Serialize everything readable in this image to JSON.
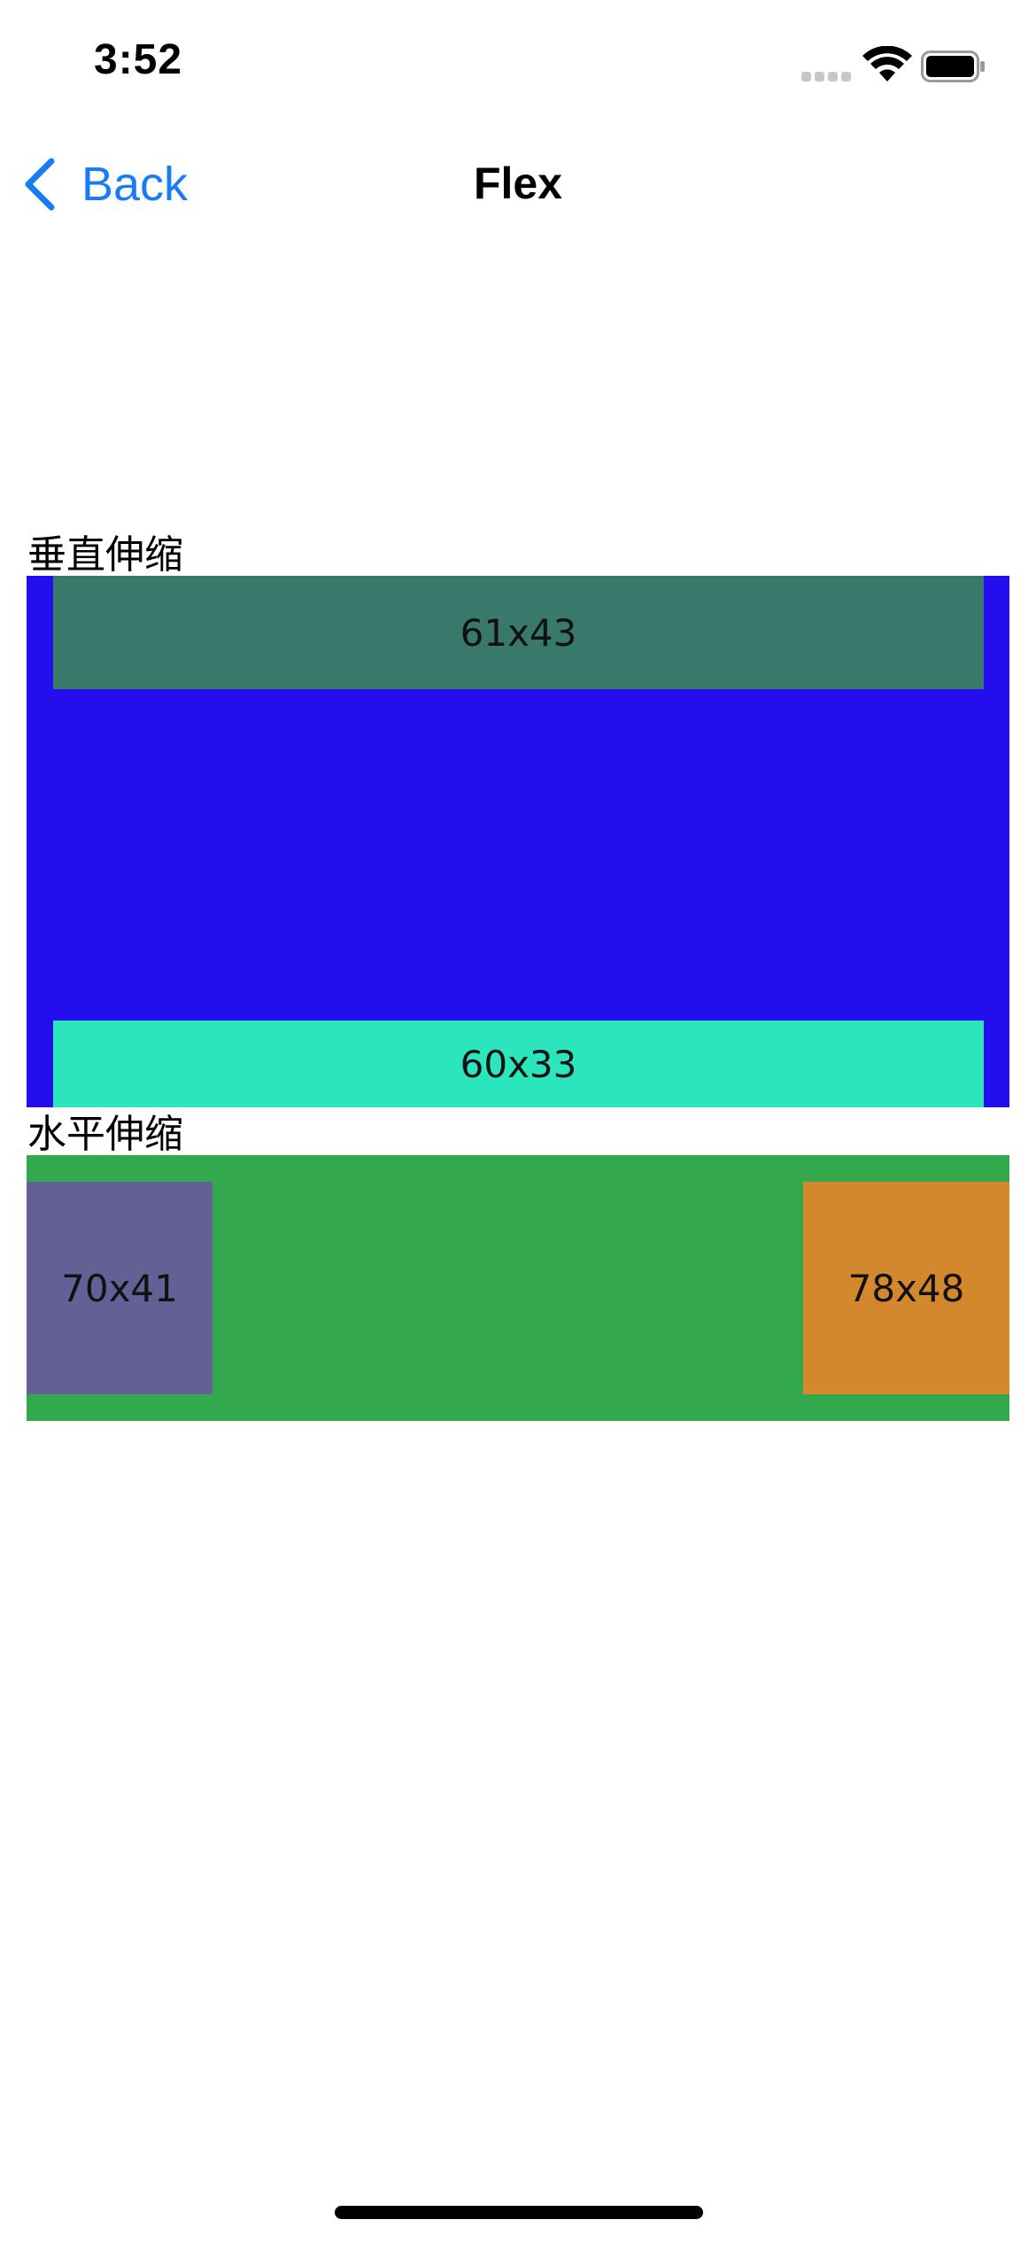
{
  "status_bar": {
    "time": "3:52",
    "icons": [
      "cellular-signal-icon",
      "wifi-icon",
      "battery-icon"
    ]
  },
  "nav": {
    "back_label": "Back",
    "title": "Flex",
    "accent_color": "#1a7cf5"
  },
  "vertical_section": {
    "label": "垂直伸缩",
    "container_color": "#240eed",
    "items": [
      {
        "label": "61x43",
        "color": "#38796c"
      },
      {
        "label": "60x33",
        "color": "#2be6bd"
      }
    ]
  },
  "horizontal_section": {
    "label": "水平伸缩",
    "container_color": "#34a84c",
    "items": [
      {
        "label": "70x41",
        "color": "#636096"
      },
      {
        "label": "78x48",
        "color": "#d4882e"
      }
    ]
  }
}
